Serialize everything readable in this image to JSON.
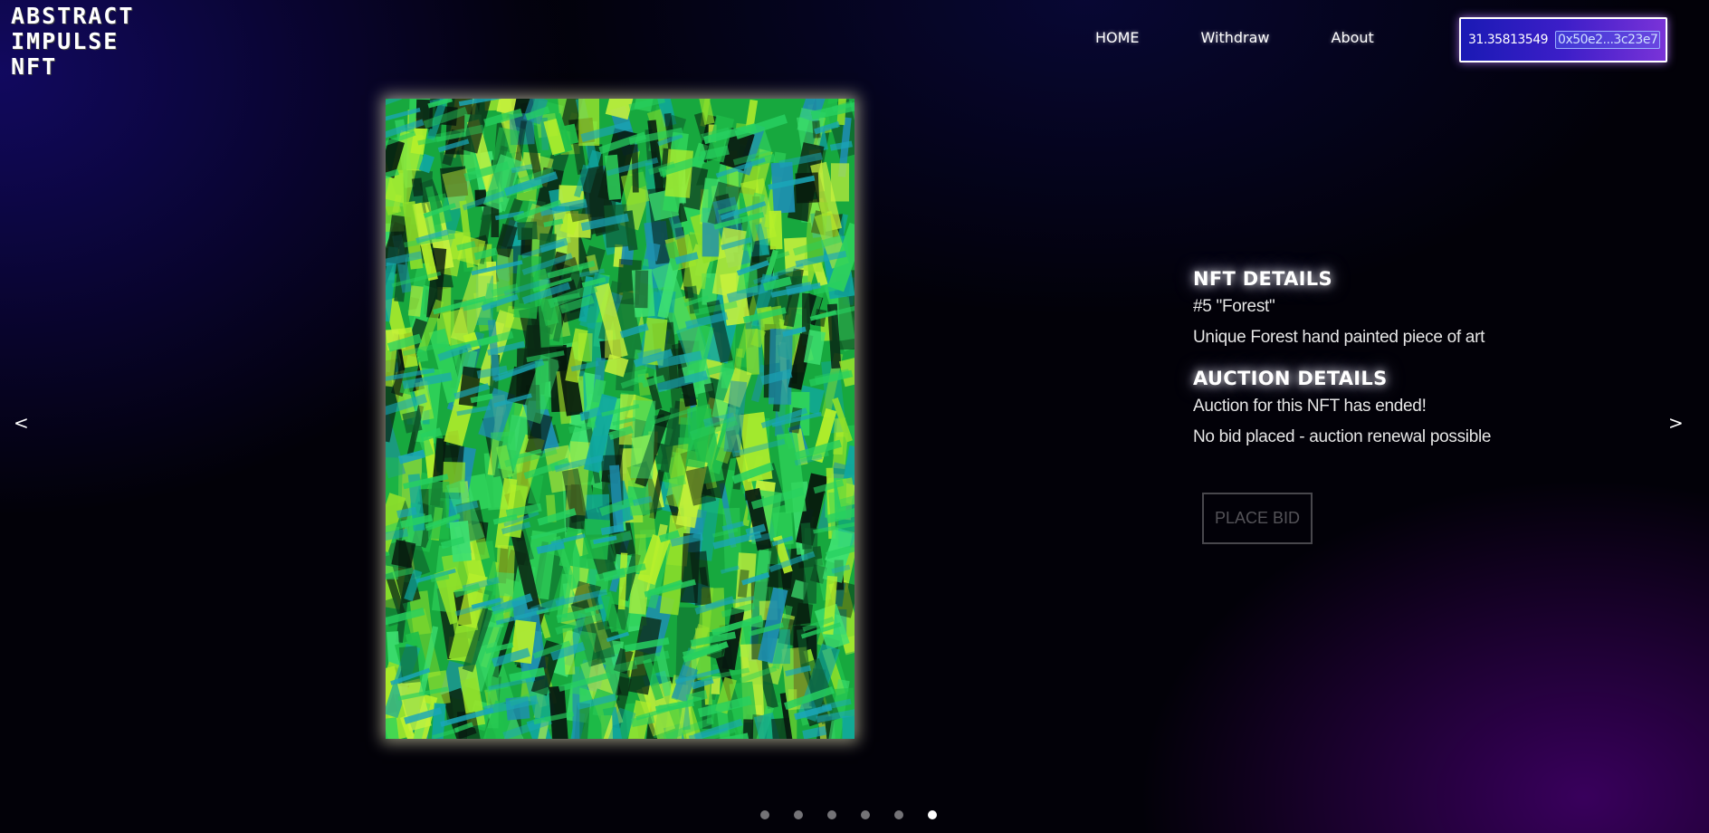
{
  "logo": {
    "line1": "ABSTRACT",
    "line2": "IMPULSE",
    "line3": "NFT"
  },
  "nav": {
    "home": "HOME",
    "withdraw": "Withdraw",
    "about": "About"
  },
  "wallet": {
    "balance": "31.35813549",
    "address": "0x50e2...3c23e7"
  },
  "artwork": {
    "icon": "forest-painting-image"
  },
  "details": {
    "nft_heading": "NFT DETAILS",
    "nft_title": "#5 \"Forest\"",
    "nft_description": "Unique Forest hand painted piece of art",
    "auction_heading": "AUCTION DETAILS",
    "auction_status": "Auction for this NFT has ended!",
    "auction_note": "No bid placed - auction renewal possible"
  },
  "bid_button": {
    "label": "PLACE BID",
    "enabled": false
  },
  "carousel": {
    "prev": "<",
    "next": ">",
    "slide_count": 6,
    "active_index": 6
  },
  "colors": {
    "accent": "#3c1ec8",
    "glow": "#ffffd2"
  }
}
